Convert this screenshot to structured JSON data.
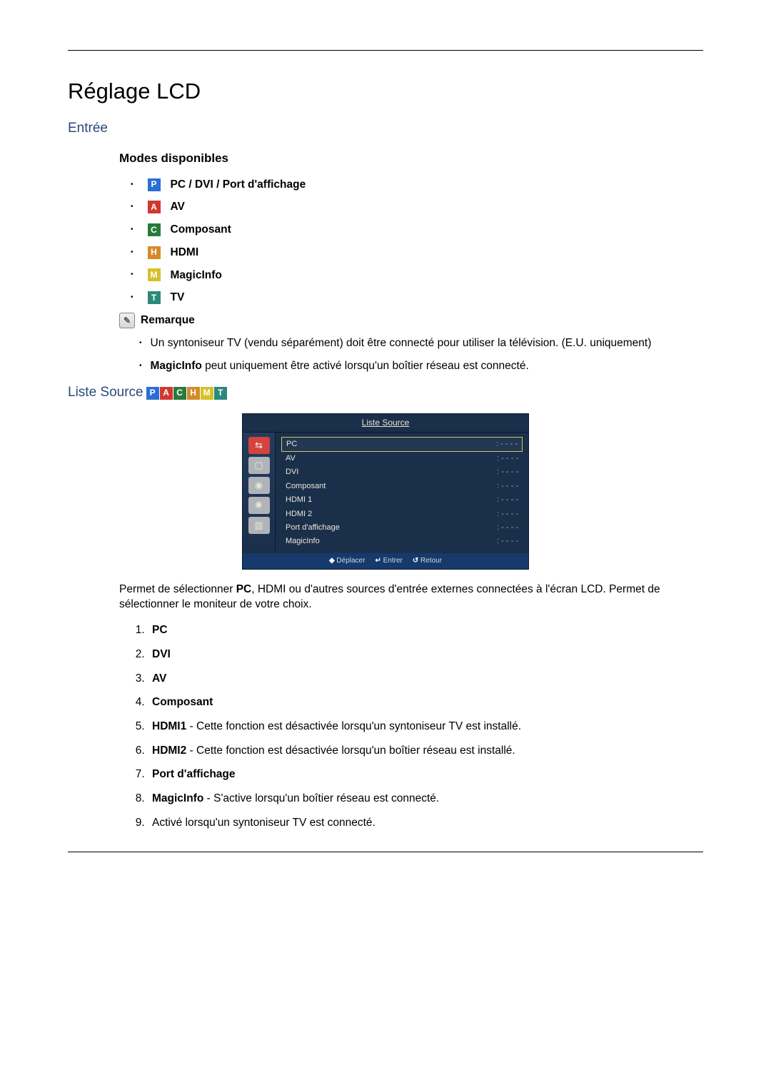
{
  "page_title": "Réglage LCD",
  "entree_heading": "Entrée",
  "modes_heading": "Modes disponibles",
  "modes": [
    {
      "tag": "P",
      "tag_class": "tag-p",
      "label": "PC / DVI / Port d'affichage"
    },
    {
      "tag": "A",
      "tag_class": "tag-a",
      "label": "AV"
    },
    {
      "tag": "C",
      "tag_class": "tag-c",
      "label": "Composant"
    },
    {
      "tag": "H",
      "tag_class": "tag-h",
      "label": "HDMI"
    },
    {
      "tag": "M",
      "tag_class": "tag-m",
      "label": "MagicInfo"
    },
    {
      "tag": "T",
      "tag_class": "tag-t",
      "label": "TV"
    }
  ],
  "remark_label": "Remarque",
  "notes": [
    {
      "text": "Un syntoniseur TV (vendu séparément) doit être connecté pour utiliser la télévision. (E.U. uniquement)"
    },
    {
      "prefix": "MagicInfo",
      "text": " peut uniquement être activé lorsqu'un boîtier réseau est connecté."
    }
  ],
  "liste_heading": "Liste Source",
  "liste_tags": [
    "P",
    "A",
    "C",
    "H",
    "M",
    "T"
  ],
  "osd": {
    "title": "Liste Source",
    "rows": [
      {
        "name": "PC",
        "val": "- - - -",
        "selected": true
      },
      {
        "name": "AV",
        "val": "- - - -"
      },
      {
        "name": "DVI",
        "val": "- - - -"
      },
      {
        "name": "Composant",
        "val": "- - - -"
      },
      {
        "name": "HDMI 1",
        "val": "- - - -"
      },
      {
        "name": "HDMI 2",
        "val": "- - - -"
      },
      {
        "name": "Port d'affichage",
        "val": "- - - -"
      },
      {
        "name": "MagicInfo",
        "val": "- - - -"
      }
    ],
    "footer": {
      "move": "Déplacer",
      "enter": "Entrer",
      "return": "Retour"
    }
  },
  "body_paragraph_pre": "Permet de sélectionner ",
  "body_paragraph_bold": "PC",
  "body_paragraph_post": ", HDMI ou d'autres sources d'entrée externes connectées à l'écran LCD. Permet de sélectionner le moniteur de votre choix.",
  "src_list": [
    {
      "lead": "PC",
      "rest": ""
    },
    {
      "lead": "DVI",
      "rest": ""
    },
    {
      "lead": "AV",
      "rest": ""
    },
    {
      "lead": "Composant",
      "rest": ""
    },
    {
      "lead": "HDMI1",
      "rest": " - Cette fonction est désactivée lorsqu'un syntoniseur TV est installé."
    },
    {
      "lead": "HDMI2",
      "rest": " - Cette fonction est désactivée lorsqu'un boîtier réseau est installé."
    },
    {
      "lead": "Port d'affichage",
      "rest": ""
    },
    {
      "lead": "MagicInfo",
      "rest": " - S'active lorsqu'un boîtier réseau est connecté."
    },
    {
      "lead": "",
      "rest": "Activé lorsqu'un syntoniseur TV est connecté."
    }
  ]
}
